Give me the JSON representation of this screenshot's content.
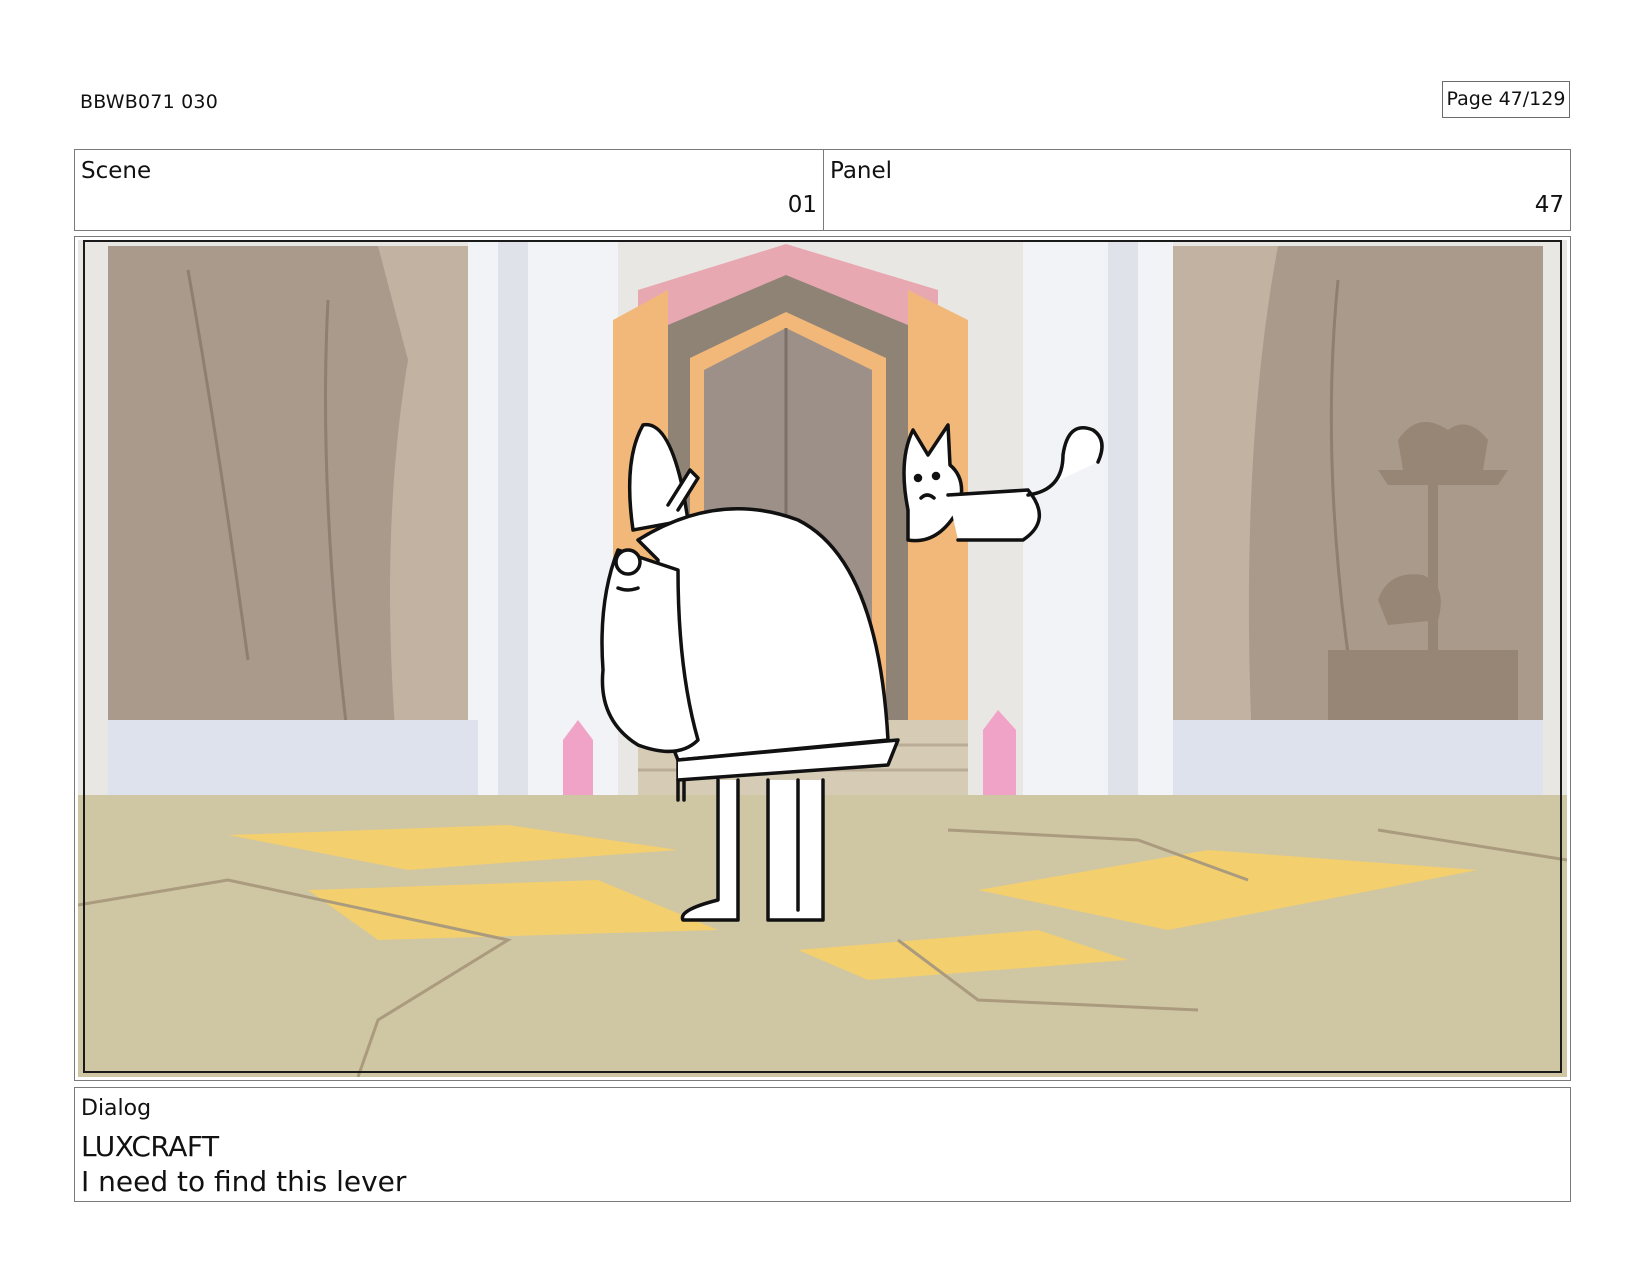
{
  "header": {
    "doc_id": "BBWB071 030",
    "page_label": "Page  47/129"
  },
  "scene": {
    "label": "Scene",
    "value": "01"
  },
  "panel": {
    "label": "Panel",
    "value": "47"
  },
  "dialog": {
    "label": "Dialog",
    "character": "LUXCRAFT",
    "line": "I need to find this lever"
  },
  "colors": {
    "frame_border": "#7a7a7a",
    "floor": "#cfc6a4",
    "floor_highlight": "#f3cf6e",
    "wall_rock": "#a99a8c",
    "door_pink": "#e8a8b2",
    "door_orange": "#f1b879",
    "door_dark": "#8f8376",
    "crystal_pink": "#f0a3c7"
  },
  "illustration": {
    "characters": [
      "wizard-figure",
      "cat-creature"
    ],
    "setting": "temple-hall"
  }
}
